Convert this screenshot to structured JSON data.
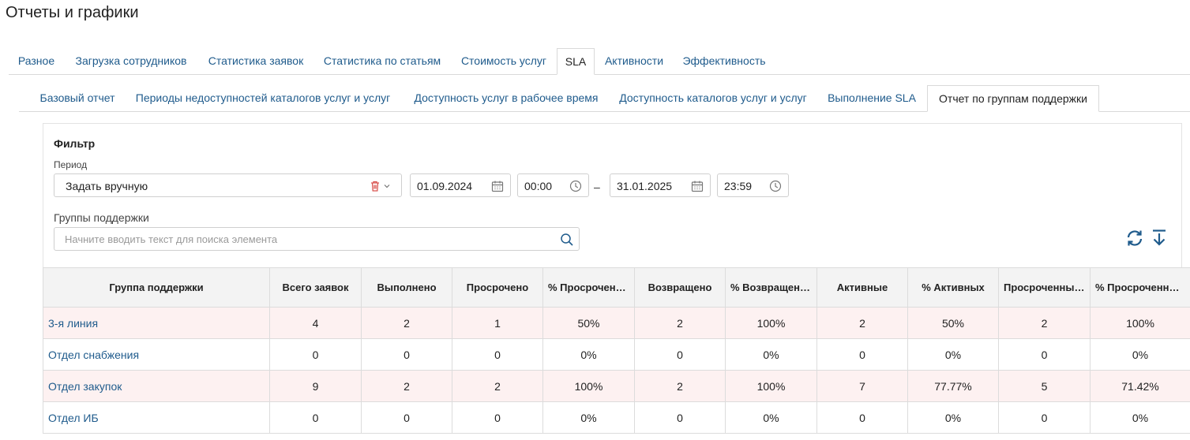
{
  "page_title": "Отчеты и графики",
  "main_tabs": [
    {
      "label": "Разное"
    },
    {
      "label": "Загрузка сотрудников"
    },
    {
      "label": "Статистика заявок"
    },
    {
      "label": "Статистика по статьям"
    },
    {
      "label": "Стоимость услуг"
    },
    {
      "label": "SLA",
      "active": true
    },
    {
      "label": "Активности"
    },
    {
      "label": "Эффективность"
    }
  ],
  "sub_tabs": [
    {
      "label": "Базовый отчет"
    },
    {
      "label": "Периоды недоступностей каталогов услуг и услуг"
    },
    {
      "label": "Доступность услуг в рабочее время"
    },
    {
      "label": "Доступность каталогов услуг и услуг"
    },
    {
      "label": "Выполнение SLA"
    },
    {
      "label": "Отчет по группам поддержки",
      "active": true
    }
  ],
  "filter": {
    "title": "Фильтр",
    "period_label": "Период",
    "period_value": "Задать вручную",
    "date_from": "01.09.2024",
    "time_from": "00:00",
    "separator": "–",
    "date_to": "31.01.2025",
    "time_to": "23:59",
    "groups_label": "Группы поддержки",
    "groups_placeholder": "Начните вводить текст для поиска элемента"
  },
  "colors": {
    "link": "#1f5b8c",
    "alert_row": "#fdf1f1",
    "delete_icon": "#d9534f"
  },
  "table": {
    "headers": [
      "Группа поддержки",
      "Всего заявок",
      "Выполнено",
      "Просрочено",
      "% Просроченных",
      "Возвращено",
      "% Возвращенных",
      "Активные",
      "% Активных",
      "Просроченные активные",
      "% Просроченных активных"
    ],
    "rows": [
      {
        "alert": true,
        "cells": [
          "3-я линия",
          "4",
          "2",
          "1",
          "50%",
          "2",
          "100%",
          "2",
          "50%",
          "2",
          "100%"
        ]
      },
      {
        "alert": false,
        "cells": [
          "Отдел снабжения",
          "0",
          "0",
          "0",
          "0%",
          "0",
          "0%",
          "0",
          "0%",
          "0",
          "0%"
        ]
      },
      {
        "alert": true,
        "cells": [
          "Отдел закупок",
          "9",
          "2",
          "2",
          "100%",
          "2",
          "100%",
          "7",
          "77.77%",
          "5",
          "71.42%"
        ]
      },
      {
        "alert": false,
        "cells": [
          "Отдел ИБ",
          "0",
          "0",
          "0",
          "0%",
          "0",
          "0%",
          "0",
          "0%",
          "0",
          "0%"
        ]
      }
    ]
  }
}
